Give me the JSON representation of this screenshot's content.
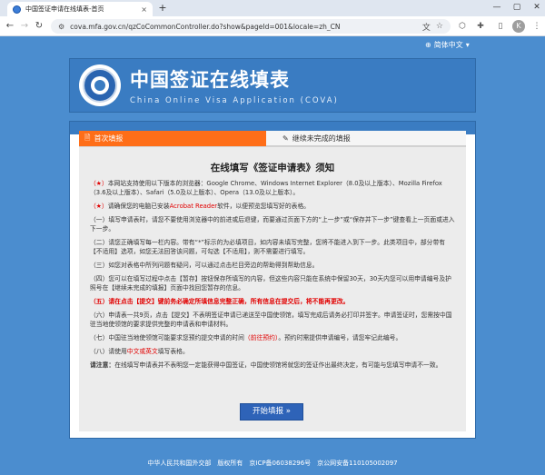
{
  "browser": {
    "tab_title": "中国签证申请在线填表-首页",
    "tab_close": "×",
    "new_tab": "+",
    "minimize": "—",
    "maximize": "▢",
    "close_window": "✕",
    "url": "cova.mfa.gov.cn/qzCoCommonController.do?show&pageId=001&locale=zh_CN",
    "profile_initial": "K"
  },
  "page": {
    "language": "简体中文",
    "banner_title_cn": "中国签证在线填表",
    "banner_title_en": "China Online Visa Application (COVA)",
    "tabs": {
      "first": "首次填报",
      "continue": "继续未完成的填报"
    },
    "notice_title": "在线填写《签证申请表》须知",
    "paragraphs": [
      {
        "prefix": "（★）",
        "text": "本网站支持使用以下版本的浏览器：Google Chrome、Windows Internet Explorer（8.0及以上版本）、Mozilla Firefox（3.6及以上版本）、Safari（5.0及以上版本）、Opera（13.0及以上版本）。"
      },
      {
        "prefix": "（★）",
        "text_before": "请确保您的电脑已安装",
        "highlight": "Acrobat Reader",
        "text_after": "软件，以便预览您填写好的表格。"
      },
      {
        "text": "（一）填写申请表时，请您不要使用浏览器中的前进或后退键，而要通过页面下方的“上一步”或“保存并下一步”键查看上一页面或进入下一步。"
      },
      {
        "text": "（二）请您正确填写每一栏内容。带有“*”标示的为必填项目，如内容未填写完整，您将不能进入到下一步。此类项目中，部分带有【不适用】选项，如您无法回答该问题，可勾选【不适用】，则不需要进行填写。"
      },
      {
        "text": "（三）如您对表格中所列问题有疑问，可以通过点击栏目旁边的帮助得到帮助信息。"
      },
      {
        "text": "（四）您可以在填写过程中点击【暂存】按钮保存所填写的内容，但这些内容只能在系统中保留30天，30天内您可以用申请编号及护照号在【继续未完成的填报】页面中找回您暂存的信息。"
      },
      {
        "red_bold": "（五）请在点击【提交】键前务必确定所填信息完整正确，所有信息在提交后，将不能再更改。"
      },
      {
        "text": "（六）申请表一共9页，点击【提交】不表明签证申请已递送至中国使领馆，填写完成后请务必打印并签字。申请签证时，您需按中国驻当地使领馆的要求提供完整的申请表和申请材料。"
      },
      {
        "text_before": "（七）中国驻当地使领馆可能要求您预约提交申请的时间",
        "highlight": "（前往预约）",
        "text_after": "。预约时需提供申请编号，请您牢记此编号。"
      },
      {
        "text_before": "（八）请使用",
        "highlight": "中文或英文",
        "text_after": "填写表格。"
      },
      {
        "bold": "请注意：",
        "text": "在线填写申请表并不表明您一定能获得中国签证，中国使领馆将就您的签证作出最终决定，有可能与您填写申请不一致。"
      }
    ],
    "start_button": "开始填报 »",
    "footer": "中华人民共和国外交部　版权所有　京ICP备06038296号　京公网安备110105002097"
  }
}
